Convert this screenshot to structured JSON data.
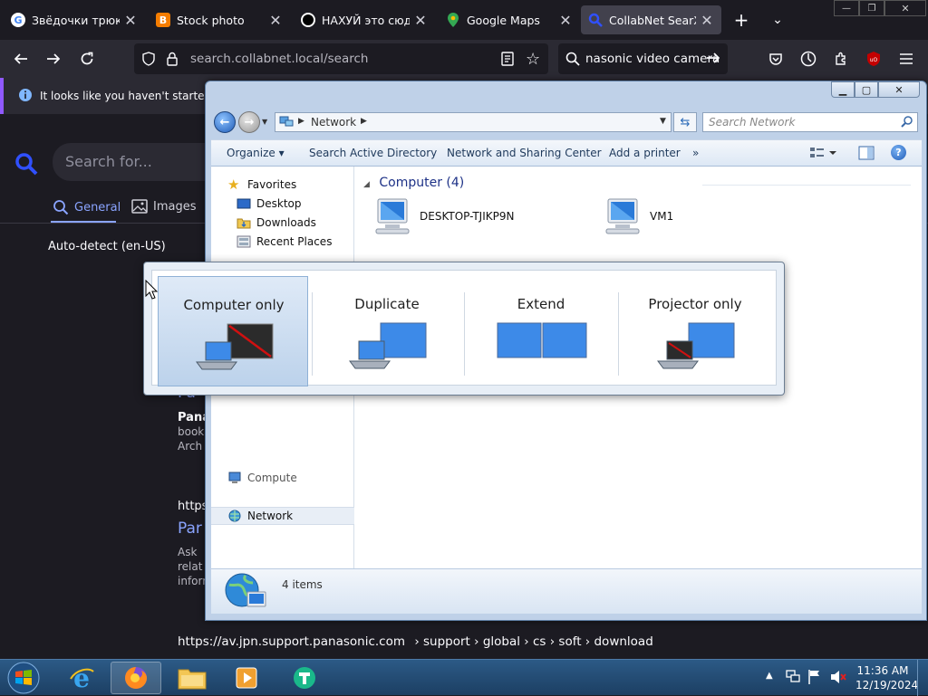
{
  "browser": {
    "tabs": [
      {
        "title": "Звёдочки трюк а",
        "favicon": "google-icon",
        "active": false
      },
      {
        "title": "Stock photo",
        "favicon": "blogger-icon",
        "active": false
      },
      {
        "title": "НАХУЙ это сюда",
        "favicon": "circle-icon",
        "active": false
      },
      {
        "title": "Google Maps",
        "favicon": "maps-pin-icon",
        "active": false
      },
      {
        "title": "CollabNet SearXNG",
        "favicon": "searxng-icon",
        "active": true
      }
    ],
    "new_tab_label": "+",
    "url": "search.collabnet.local/search",
    "search_query": "Panasonic video camera",
    "search_visible": "nasonic video camera",
    "notification": "It looks like you haven't started Fir",
    "accent_color": "#9059ff"
  },
  "webpage": {
    "search_placeholder": "Search for...",
    "tabs": [
      "General",
      "Images"
    ],
    "language": "Auto-detect (en-US)",
    "results": [
      {
        "title_fragment": "Pa",
        "line_a": "Pana",
        "line_b": "book",
        "line_c": "Arch"
      },
      {
        "url_fragment": "https",
        "title_fragment": "Par",
        "line_a": "Ask",
        "line_b": "relat",
        "line_c": "inform"
      }
    ],
    "footer_url": "https://av.jpn.support.panasonic.com",
    "footer_path": "› support › global › cs › soft › download"
  },
  "explorer": {
    "address": "Network",
    "search_placeholder": "Search Network",
    "commands": [
      "Organize",
      "Search Active Directory",
      "Network and Sharing Center",
      "Add a printer",
      "»"
    ],
    "nav": {
      "favorites_label": "Favorites",
      "favorites": [
        "Desktop",
        "Downloads",
        "Recent Places"
      ],
      "computer_label": "Compute",
      "network_label": "Network"
    },
    "group_label": "Computer (4)",
    "computers": [
      "DESKTOP-TJIKP9N",
      "VM1"
    ],
    "details": "4 items"
  },
  "projector": {
    "options": [
      {
        "label": "Computer only",
        "selected": true
      },
      {
        "label": "Duplicate",
        "selected": false
      },
      {
        "label": "Extend",
        "selected": false
      },
      {
        "label": "Projector only",
        "selected": false
      }
    ]
  },
  "taskbar": {
    "time": "11:36 AM",
    "date": "12/19/2024",
    "apps": [
      "windows-start-icon",
      "internet-explorer-icon",
      "firefox-icon",
      "file-explorer-icon",
      "media-player-icon",
      "teams-icon"
    ]
  }
}
